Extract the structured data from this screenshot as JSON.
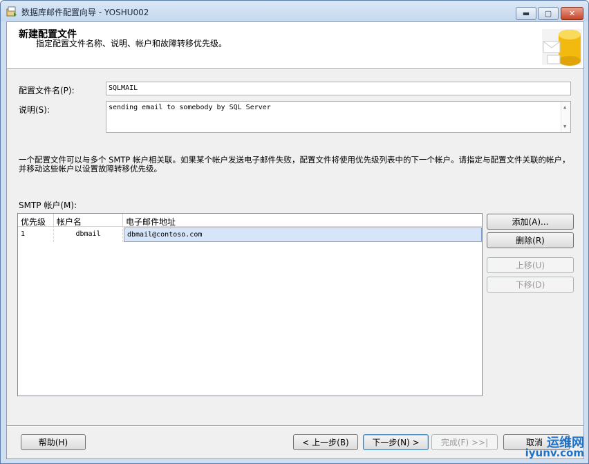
{
  "window": {
    "title": "数据库邮件配置向导 - YOSHU002",
    "min_icon": "minimize-icon",
    "max_icon": "maximize-icon",
    "close_icon": "close-icon",
    "min_glyph": "▬",
    "max_glyph": "▢",
    "close_glyph": "✕"
  },
  "header": {
    "title": "新建配置文件",
    "subtitle": "指定配置文件名称、说明、帐户和故障转移优先级。"
  },
  "form": {
    "profile_name_label": "配置文件名(P):",
    "profile_name_value": "SQLMAIL",
    "description_label": "说明(S):",
    "description_value": "sending email to somebody by SQL Server",
    "scroll_up": "▲",
    "scroll_down": "▼"
  },
  "info_text": "一个配置文件可以与多个 SMTP 帐户相关联。如果某个帐户发送电子邮件失败，配置文件将使用优先级列表中的下一个帐户。请指定与配置文件关联的帐户，并移动这些帐户以设置故障转移优先级。",
  "smtp": {
    "label": "SMTP 帐户(M):",
    "columns": [
      "优先级",
      "帐户名",
      "电子邮件地址"
    ],
    "rows": [
      {
        "priority": "1",
        "account": "dbmail",
        "email": "dbmail@contoso.com"
      }
    ],
    "buttons": {
      "add": "添加(A)...",
      "remove": "删除(R)",
      "move_up": "上移(U)",
      "move_down": "下移(D)"
    }
  },
  "footer": {
    "help": "帮助(H)",
    "back": "< 上一步(B)",
    "next": "下一步(N) >",
    "finish": "完成(F) >>|",
    "cancel": "取消"
  },
  "watermark": {
    "line1": "运维网",
    "line2": "iyunv.com"
  },
  "colors": {
    "accent": "#1e73c8",
    "selection": "#d6e6f8"
  }
}
